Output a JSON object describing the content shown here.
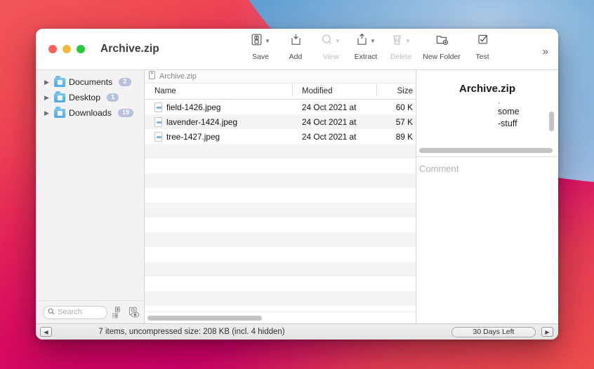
{
  "window": {
    "title": "Archive.zip",
    "traffic_lights": [
      "close-button",
      "minimize-button",
      "maximize-button"
    ]
  },
  "toolbar": {
    "items": [
      {
        "label": "Save",
        "icon": "save-icon",
        "has_chevron": true,
        "disabled": false
      },
      {
        "label": "Add",
        "icon": "add-icon",
        "has_chevron": false,
        "disabled": false
      },
      {
        "label": "View",
        "icon": "view-icon",
        "has_chevron": true,
        "disabled": true
      },
      {
        "label": "Extract",
        "icon": "extract-icon",
        "has_chevron": true,
        "disabled": false
      },
      {
        "label": "Delete",
        "icon": "delete-icon",
        "has_chevron": true,
        "disabled": true
      },
      {
        "label": "New Folder",
        "icon": "new-folder-icon",
        "has_chevron": false,
        "disabled": false
      },
      {
        "label": "Test",
        "icon": "test-icon",
        "has_chevron": false,
        "disabled": false
      }
    ],
    "overflow": "»"
  },
  "sidebar": {
    "items": [
      {
        "label": "Documents",
        "badge": "2"
      },
      {
        "label": "Desktop",
        "badge": "1"
      },
      {
        "label": "Downloads",
        "badge": "19"
      }
    ],
    "search": {
      "placeholder": "Search",
      "value": ""
    },
    "tools": [
      "grid-view-icon",
      "preview-icon"
    ]
  },
  "pathbar": {
    "label": "Archive.zip"
  },
  "filelist": {
    "columns": [
      "Name",
      "Modified",
      "Size"
    ],
    "rows": [
      {
        "name": "field-1426.jpeg",
        "modified": "24 Oct 2021 at",
        "size": "60 K"
      },
      {
        "name": "lavender-1424.jpeg",
        "modified": "24 Oct 2021 at",
        "size": "57 K"
      },
      {
        "name": "tree-1427.jpeg",
        "modified": "24 Oct 2021 at",
        "size": "89 K"
      }
    ]
  },
  "infopanel": {
    "title": "Archive.zip",
    "clipped_line_1": "some",
    "clipped_line_2": "-stuff",
    "comment_placeholder": "Comment"
  },
  "statusbar": {
    "text": "7 items, uncompressed size: 208 KB (incl. 4 hidden)",
    "trial": "30 Days Left",
    "left_button": "◀",
    "right_button": "▶"
  },
  "colors": {
    "folder_blue": "#4fa9e8",
    "badge": "#b6c2dd",
    "traffic_red": "#fc5f57",
    "traffic_yellow": "#f0bc3f",
    "traffic_green": "#2bc93e"
  }
}
